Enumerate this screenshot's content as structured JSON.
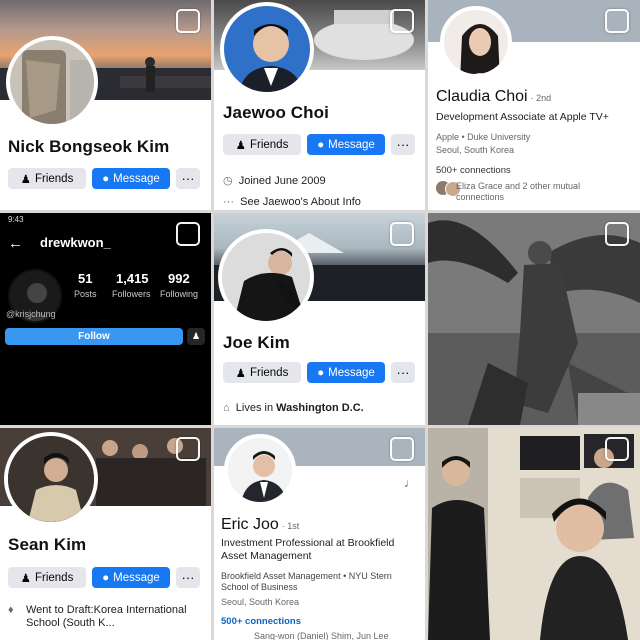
{
  "buttons": {
    "friends": "Friends",
    "message": "Message",
    "more": "···",
    "follow": "Follow"
  },
  "nick": {
    "name": "Nick Bongseok Kim"
  },
  "jaewoo": {
    "name": "Jaewoo Choi",
    "joined": "Joined June 2009",
    "see_about": "See Jaewoo's About Info"
  },
  "claudia": {
    "name": "Claudia Choi",
    "degree": "· 2nd",
    "headline": "Development Associate at Apple TV+",
    "education": "Apple • Duke University",
    "location": "Seoul, South Korea",
    "connections": "500+ connections",
    "mutual": "Eliza Grace and 2 other mutual connections"
  },
  "drew": {
    "time": "9:43",
    "username": "drewkwon_",
    "handle": "@krisjchung",
    "stats": [
      {
        "value": "51",
        "label": "Posts"
      },
      {
        "value": "1,415",
        "label": "Followers"
      },
      {
        "value": "992",
        "label": "Following"
      }
    ]
  },
  "joe": {
    "name": "Joe Kim",
    "lives_prefix": "Lives in",
    "lives_place": "Washington D.C."
  },
  "sean": {
    "name": "Sean Kim",
    "went_to": "Went to Draft:Korea International School (South K..."
  },
  "eric": {
    "name": "Eric Joo",
    "degree": "· 1st",
    "headline": "Investment Professional at Brookfield Asset Management",
    "education": "Brookfield Asset Management • NYU Stern School of Business",
    "location": "Seoul, South Korea",
    "connections": "500+ connections",
    "mutual": "Sang-won (Daniel) Shim, Jun Lee"
  },
  "colors": {
    "facebook_blue": "#1877f2",
    "button_gray": "#e4e6eb",
    "linkedin_link": "#0a66c2",
    "instagram_blue": "#3897f0"
  }
}
